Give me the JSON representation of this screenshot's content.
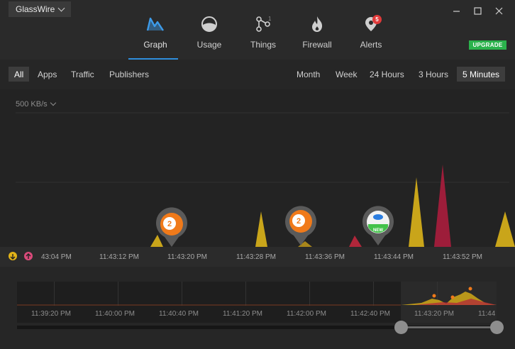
{
  "app": {
    "title": "GlassWire"
  },
  "nav": {
    "graph": "Graph",
    "usage": "Usage",
    "things": "Things",
    "things_count": "1",
    "firewall": "Firewall",
    "alerts": "Alerts",
    "alerts_badge": "5"
  },
  "upgrade_label": "UPGRADE",
  "filters": {
    "left": [
      "All",
      "Apps",
      "Traffic",
      "Publishers"
    ],
    "left_selected": "All",
    "right": [
      "Month",
      "Week",
      "24 Hours",
      "3 Hours",
      "5 Minutes"
    ],
    "right_selected": "5 Minutes"
  },
  "graph": {
    "scale": "500 KB/s",
    "axis_ticks": [
      "43:04 PM",
      "11:43:12 PM",
      "11:43:20 PM",
      "11:43:28 PM",
      "11:43:36 PM",
      "11:43:44 PM",
      "11:43:52 PM"
    ],
    "markers": [
      {
        "kind": "count",
        "value": "2"
      },
      {
        "kind": "count",
        "value": "2"
      },
      {
        "kind": "new",
        "value": "NEW"
      }
    ]
  },
  "timeline": {
    "ticks": [
      "11:39:20 PM",
      "11:40:00 PM",
      "11:40:40 PM",
      "11:41:20 PM",
      "11:42:00 PM",
      "11:42:40 PM",
      "11:43:20 PM",
      "11:44"
    ]
  },
  "colors": {
    "download": "#e2b318",
    "upload": "#d94a7a",
    "accent": "#2f8fdd",
    "upgrade": "#2bb24c",
    "marker": "#f07a1a"
  }
}
